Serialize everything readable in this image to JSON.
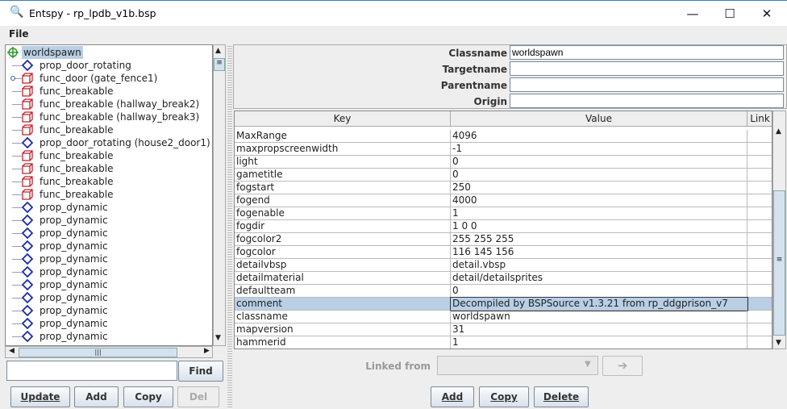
{
  "window": {
    "title": "Entspy - rp_lpdb_v1b.bsp",
    "minimize": "—",
    "maximize": "☐",
    "close": "✕"
  },
  "menu": {
    "file": "File"
  },
  "tree": {
    "items": [
      {
        "label": "worldspawn",
        "icon": "crosshair",
        "selected": true
      },
      {
        "label": "prop_door_rotating",
        "icon": "diamond"
      },
      {
        "label": "func_door (gate_fence1)",
        "icon": "cube",
        "linked": true
      },
      {
        "label": "func_breakable",
        "icon": "cube"
      },
      {
        "label": "func_breakable (hallway_break2)",
        "icon": "cube"
      },
      {
        "label": "func_breakable (hallway_break3)",
        "icon": "cube"
      },
      {
        "label": "func_breakable",
        "icon": "cube"
      },
      {
        "label": "prop_door_rotating (house2_door1)",
        "icon": "diamond"
      },
      {
        "label": "func_breakable",
        "icon": "cube"
      },
      {
        "label": "func_breakable",
        "icon": "cube"
      },
      {
        "label": "func_breakable",
        "icon": "cube"
      },
      {
        "label": "func_breakable",
        "icon": "cube"
      },
      {
        "label": "prop_dynamic",
        "icon": "diamond"
      },
      {
        "label": "prop_dynamic",
        "icon": "diamond"
      },
      {
        "label": "prop_dynamic",
        "icon": "diamond"
      },
      {
        "label": "prop_dynamic",
        "icon": "diamond"
      },
      {
        "label": "prop_dynamic",
        "icon": "diamond"
      },
      {
        "label": "prop_dynamic",
        "icon": "diamond"
      },
      {
        "label": "prop_dynamic",
        "icon": "diamond"
      },
      {
        "label": "prop_dynamic",
        "icon": "diamond"
      },
      {
        "label": "prop_dynamic",
        "icon": "diamond"
      },
      {
        "label": "prop_dynamic",
        "icon": "diamond"
      },
      {
        "label": "prop_dynamic",
        "icon": "diamond"
      }
    ]
  },
  "left": {
    "find_value": "",
    "find": "Find",
    "update": "Update",
    "add": "Add",
    "copy": "Copy",
    "del": "Del"
  },
  "form": {
    "classname_label": "Classname",
    "classname": "worldspawn",
    "targetname_label": "Targetname",
    "targetname": "",
    "parentname_label": "Parentname",
    "parentname": "",
    "origin_label": "Origin",
    "origin": ""
  },
  "table": {
    "headers": [
      "Key",
      "Value",
      "Link"
    ],
    "rows": [
      [
        "MaxRange",
        "4096"
      ],
      [
        "maxpropscreenwidth",
        "-1"
      ],
      [
        "light",
        "0"
      ],
      [
        "gametitle",
        "0"
      ],
      [
        "fogstart",
        "250"
      ],
      [
        "fogend",
        "4000"
      ],
      [
        "fogenable",
        "1"
      ],
      [
        "fogdir",
        "1 0 0"
      ],
      [
        "fogcolor2",
        "255 255 255"
      ],
      [
        "fogcolor",
        "116 145 156"
      ],
      [
        "detailvbsp",
        "detail.vbsp"
      ],
      [
        "detailmaterial",
        "detail/detailsprites"
      ],
      [
        "defaultteam",
        "0"
      ],
      [
        "comment",
        "Decompiled by BSPSource v1.3.21 from rp_ddgprison_v7"
      ],
      [
        "classname",
        "worldspawn"
      ],
      [
        "mapversion",
        "31"
      ],
      [
        "hammerid",
        "1"
      ]
    ],
    "selected_row": 13
  },
  "right": {
    "linked_from": "Linked from",
    "linked_value": "",
    "go": "➔",
    "add": "Add",
    "copy": "Copy",
    "delete": "Delete"
  }
}
